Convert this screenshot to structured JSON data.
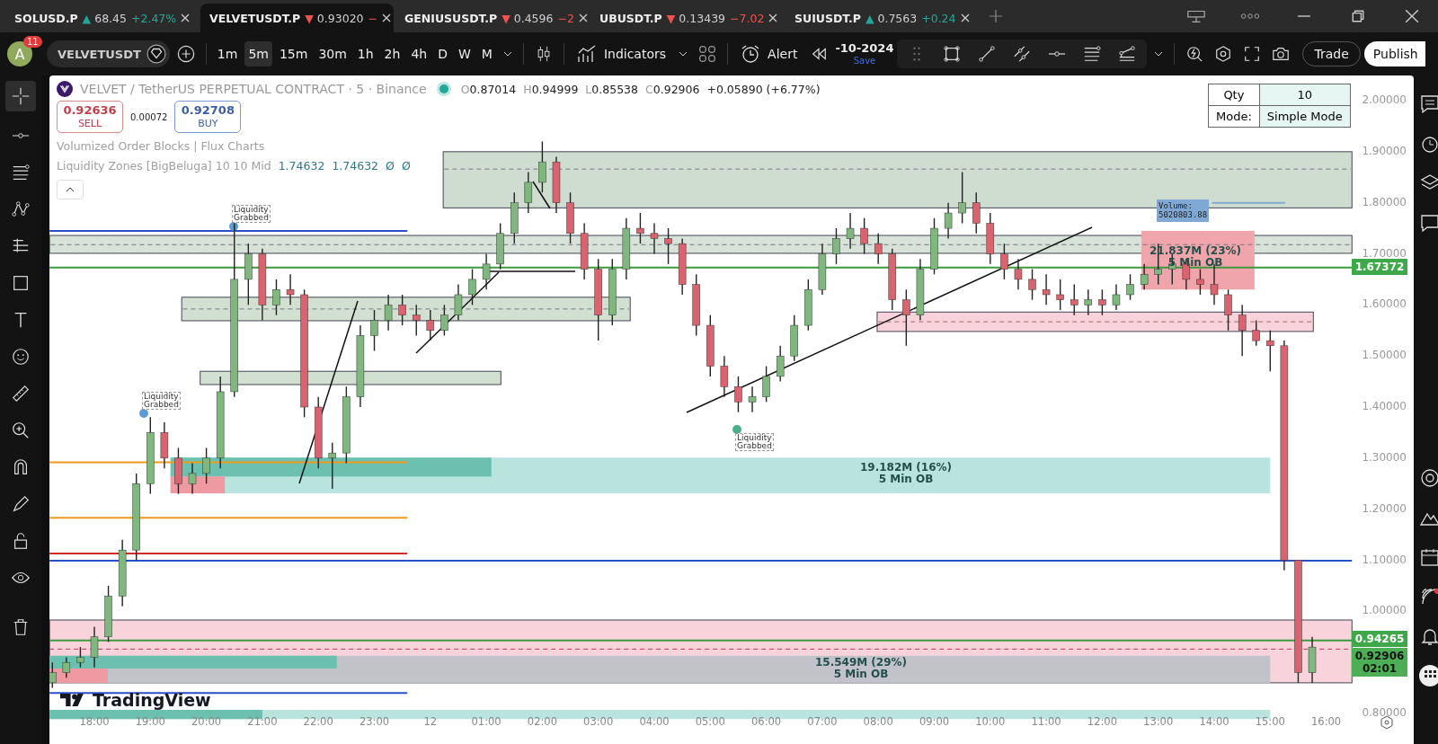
{
  "tabs": [
    {
      "symbol": "SOLUSD.P",
      "arrow": "▲",
      "price": "68.45",
      "change": "+2.47%",
      "rising": true,
      "selected": false
    },
    {
      "symbol": "VELVETUSDT.P",
      "arrow": "▼",
      "price": "0.93020",
      "change": "−",
      "rising": false,
      "selected": true
    },
    {
      "symbol": "GENIUSUSDT.P",
      "arrow": "▼",
      "price": "0.4596",
      "change": "−2",
      "rising": false,
      "selected": false
    },
    {
      "symbol": "UBUSDT.P",
      "arrow": "▼",
      "price": "0.13439",
      "change": "−7.02",
      "rising": false,
      "selected": false
    },
    {
      "symbol": "SUIUSDT.P",
      "arrow": "▲",
      "price": "0.7563",
      "change": "+0.24",
      "rising": true,
      "selected": false
    }
  ],
  "toolbar": {
    "avatar": "A",
    "notifications": "11",
    "symbol": "VELVETUSDT",
    "intervals": [
      {
        "label": "1m",
        "selected": false
      },
      {
        "label": "5m",
        "selected": true
      },
      {
        "label": "15m",
        "selected": false
      },
      {
        "label": "30m",
        "selected": false
      },
      {
        "label": "1h",
        "selected": false
      },
      {
        "label": "2h",
        "selected": false
      },
      {
        "label": "4h",
        "selected": false
      },
      {
        "label": "D",
        "selected": false
      },
      {
        "label": "W",
        "selected": false
      },
      {
        "label": "M",
        "selected": false
      }
    ],
    "indicators": "Indicators",
    "alert": "Alert",
    "date": "-10-2024",
    "save": "Save",
    "trade": "Trade",
    "publish": "Publish"
  },
  "legend": {
    "title": "VELVET / TetherUS PERPETUAL CONTRACT · 5 · Binance",
    "ohlc": [
      {
        "key": "O",
        "value": "0.87014"
      },
      {
        "key": "H",
        "value": "0.94999"
      },
      {
        "key": "L",
        "value": "0.85538"
      },
      {
        "key": "C",
        "value": "0.92906"
      }
    ],
    "change": "+0.05890 (+6.77%)",
    "sell": {
      "price": "0.92636",
      "label": "SELL"
    },
    "spread": "0.00072",
    "buy": {
      "price": "0.92708",
      "label": "BUY"
    },
    "indicators": [
      {
        "name": "Volumized Order Blocks | Flux Charts"
      },
      {
        "name": "Liquidity Zones [BigBeluga] 10 10 Mid",
        "values": [
          "1.74632",
          "1.74632",
          "Ø",
          "Ø"
        ]
      }
    ]
  },
  "qty_table": [
    {
      "label": "Qty",
      "value": "10"
    },
    {
      "label": "Mode:",
      "value": "Simple Mode"
    }
  ],
  "chart": {
    "chart_data": {
      "type": "candlestick",
      "ylim": [
        0.8,
        2.0
      ],
      "categories": [
        null,
        null,
        null,
        "18:00",
        null,
        null,
        null,
        "19:00",
        null,
        null,
        null,
        "20:00",
        null,
        null,
        null,
        "21:00",
        null,
        null,
        null,
        "22:00",
        null,
        null,
        null,
        "23:00",
        null,
        null,
        null,
        "12",
        null,
        null,
        null,
        "01:00",
        null,
        null,
        null,
        "02:00",
        null,
        null,
        null,
        "03:00",
        null,
        null,
        null,
        "04:00",
        null,
        null,
        null,
        "05:00",
        null,
        null,
        null,
        "06:00",
        null,
        null,
        null,
        "07:00",
        null,
        null,
        null,
        "08:00",
        null,
        null,
        null,
        "09:00",
        null,
        null,
        null,
        "10:00",
        null,
        null,
        null,
        "11:00",
        null,
        null,
        null,
        "12:00",
        null,
        null,
        null,
        "13:00",
        null,
        null,
        null,
        "14:00",
        null,
        null,
        null,
        "15:00",
        null,
        null,
        null,
        "16:00"
      ],
      "yticks": [
        {
          "value": 2.0,
          "label": "2.00000"
        },
        {
          "value": 1.9,
          "label": "1.90000"
        },
        {
          "value": 1.8,
          "label": "1.80000"
        },
        {
          "value": 1.7,
          "label": "1.70000"
        },
        {
          "value": 1.6,
          "label": "1.60000"
        },
        {
          "value": 1.5,
          "label": "1.50000"
        },
        {
          "value": 1.4,
          "label": "1.40000"
        },
        {
          "value": 1.3,
          "label": "1.30000"
        },
        {
          "value": 1.2,
          "label": "1.20000"
        },
        {
          "value": 1.1,
          "label": "1.10000"
        },
        {
          "value": 1.0,
          "label": "1.00000"
        },
        {
          "value": 0.8,
          "label": "0.80000"
        }
      ],
      "ohlc": [
        [
          0.86,
          0.9,
          0.85,
          0.88
        ],
        [
          0.88,
          0.91,
          0.87,
          0.9
        ],
        [
          0.9,
          0.93,
          0.89,
          0.91
        ],
        [
          0.91,
          0.97,
          0.89,
          0.95
        ],
        [
          0.95,
          1.05,
          0.94,
          1.03
        ],
        [
          1.03,
          1.14,
          1.01,
          1.12
        ],
        [
          1.12,
          1.27,
          1.1,
          1.25
        ],
        [
          1.25,
          1.38,
          1.23,
          1.35
        ],
        [
          1.35,
          1.37,
          1.28,
          1.3
        ],
        [
          1.3,
          1.32,
          1.23,
          1.25
        ],
        [
          1.25,
          1.29,
          1.23,
          1.27
        ],
        [
          1.27,
          1.32,
          1.25,
          1.3
        ],
        [
          1.3,
          1.46,
          1.28,
          1.43
        ],
        [
          1.43,
          1.76,
          1.42,
          1.65
        ],
        [
          1.65,
          1.72,
          1.6,
          1.7
        ],
        [
          1.7,
          1.71,
          1.57,
          1.6
        ],
        [
          1.6,
          1.65,
          1.58,
          1.63
        ],
        [
          1.63,
          1.66,
          1.6,
          1.62
        ],
        [
          1.62,
          1.63,
          1.38,
          1.4
        ],
        [
          1.4,
          1.42,
          1.28,
          1.3
        ],
        [
          1.3,
          1.33,
          1.24,
          1.31
        ],
        [
          1.31,
          1.44,
          1.29,
          1.42
        ],
        [
          1.42,
          1.56,
          1.4,
          1.54
        ],
        [
          1.54,
          1.59,
          1.51,
          1.57
        ],
        [
          1.57,
          1.62,
          1.55,
          1.6
        ],
        [
          1.6,
          1.62,
          1.56,
          1.58
        ],
        [
          1.58,
          1.6,
          1.54,
          1.57
        ],
        [
          1.57,
          1.59,
          1.53,
          1.55
        ],
        [
          1.55,
          1.6,
          1.54,
          1.58
        ],
        [
          1.58,
          1.64,
          1.57,
          1.62
        ],
        [
          1.62,
          1.67,
          1.6,
          1.65
        ],
        [
          1.65,
          1.7,
          1.63,
          1.68
        ],
        [
          1.68,
          1.76,
          1.67,
          1.74
        ],
        [
          1.74,
          1.82,
          1.72,
          1.8
        ],
        [
          1.8,
          1.86,
          1.78,
          1.84
        ],
        [
          1.84,
          1.92,
          1.82,
          1.88
        ],
        [
          1.88,
          1.89,
          1.78,
          1.8
        ],
        [
          1.8,
          1.82,
          1.72,
          1.74
        ],
        [
          1.74,
          1.76,
          1.65,
          1.67
        ],
        [
          1.67,
          1.69,
          1.53,
          1.58
        ],
        [
          1.58,
          1.69,
          1.56,
          1.67
        ],
        [
          1.67,
          1.77,
          1.65,
          1.75
        ],
        [
          1.75,
          1.78,
          1.72,
          1.74
        ],
        [
          1.74,
          1.76,
          1.7,
          1.73
        ],
        [
          1.73,
          1.75,
          1.68,
          1.72
        ],
        [
          1.72,
          1.73,
          1.62,
          1.64
        ],
        [
          1.64,
          1.66,
          1.54,
          1.56
        ],
        [
          1.56,
          1.58,
          1.46,
          1.48
        ],
        [
          1.48,
          1.5,
          1.42,
          1.44
        ],
        [
          1.44,
          1.46,
          1.39,
          1.41
        ],
        [
          1.41,
          1.44,
          1.39,
          1.42
        ],
        [
          1.42,
          1.48,
          1.41,
          1.46
        ],
        [
          1.46,
          1.52,
          1.45,
          1.5
        ],
        [
          1.5,
          1.58,
          1.49,
          1.56
        ],
        [
          1.56,
          1.65,
          1.55,
          1.63
        ],
        [
          1.63,
          1.72,
          1.62,
          1.7
        ],
        [
          1.7,
          1.75,
          1.68,
          1.73
        ],
        [
          1.73,
          1.78,
          1.71,
          1.75
        ],
        [
          1.75,
          1.77,
          1.7,
          1.72
        ],
        [
          1.72,
          1.74,
          1.68,
          1.7
        ],
        [
          1.7,
          1.71,
          1.59,
          1.61
        ],
        [
          1.61,
          1.63,
          1.52,
          1.58
        ],
        [
          1.58,
          1.69,
          1.57,
          1.67
        ],
        [
          1.67,
          1.77,
          1.66,
          1.75
        ],
        [
          1.75,
          1.8,
          1.73,
          1.78
        ],
        [
          1.78,
          1.86,
          1.76,
          1.8
        ],
        [
          1.8,
          1.82,
          1.74,
          1.76
        ],
        [
          1.76,
          1.78,
          1.68,
          1.7
        ],
        [
          1.7,
          1.72,
          1.65,
          1.67
        ],
        [
          1.67,
          1.69,
          1.63,
          1.65
        ],
        [
          1.65,
          1.67,
          1.61,
          1.63
        ],
        [
          1.63,
          1.66,
          1.6,
          1.62
        ],
        [
          1.62,
          1.65,
          1.59,
          1.61
        ],
        [
          1.61,
          1.64,
          1.58,
          1.6
        ],
        [
          1.6,
          1.63,
          1.58,
          1.61
        ],
        [
          1.61,
          1.63,
          1.58,
          1.6
        ],
        [
          1.6,
          1.64,
          1.59,
          1.62
        ],
        [
          1.62,
          1.66,
          1.61,
          1.64
        ],
        [
          1.64,
          1.68,
          1.63,
          1.66
        ],
        [
          1.66,
          1.72,
          1.64,
          1.67
        ],
        [
          1.67,
          1.7,
          1.64,
          1.68
        ],
        [
          1.68,
          1.69,
          1.63,
          1.65
        ],
        [
          1.65,
          1.67,
          1.62,
          1.64
        ],
        [
          1.64,
          1.68,
          1.6,
          1.62
        ],
        [
          1.62,
          1.63,
          1.55,
          1.58
        ],
        [
          1.58,
          1.6,
          1.5,
          1.55
        ],
        [
          1.55,
          1.57,
          1.52,
          1.53
        ],
        [
          1.53,
          1.55,
          1.47,
          1.52
        ],
        [
          1.52,
          1.53,
          1.08,
          1.1
        ],
        [
          1.1,
          1.1,
          0.86,
          0.88
        ],
        [
          0.88,
          0.95,
          0.86,
          0.93
        ],
        null
      ]
    }
  },
  "chart_labels": {
    "liquidity": [
      {
        "line1": "Liquidity",
        "line2": "Grabbed",
        "color": "#5b9bd5"
      },
      {
        "line1": "Liquidity",
        "line2": "Grabbed",
        "color": "#5b9bd5"
      },
      {
        "line1": "Liquidity",
        "line2": "Grabbed",
        "color": "#4caf8a"
      }
    ],
    "volume": {
      "line1": "Volume:",
      "line2": "5020803.88"
    },
    "order_blocks": [
      {
        "size": "21.837M (23%)",
        "label": "5 Min OB"
      },
      {
        "size": "19.182M (16%)",
        "label": "5 Min OB"
      },
      {
        "size": "15.549M (29%)",
        "label": "5 Min OB"
      }
    ],
    "logo": "TradingView"
  },
  "price_tags": [
    {
      "text": "1.67372"
    },
    {
      "text": "0.94265"
    },
    {
      "text": "0.92906",
      "countdown": "02:01"
    }
  ]
}
